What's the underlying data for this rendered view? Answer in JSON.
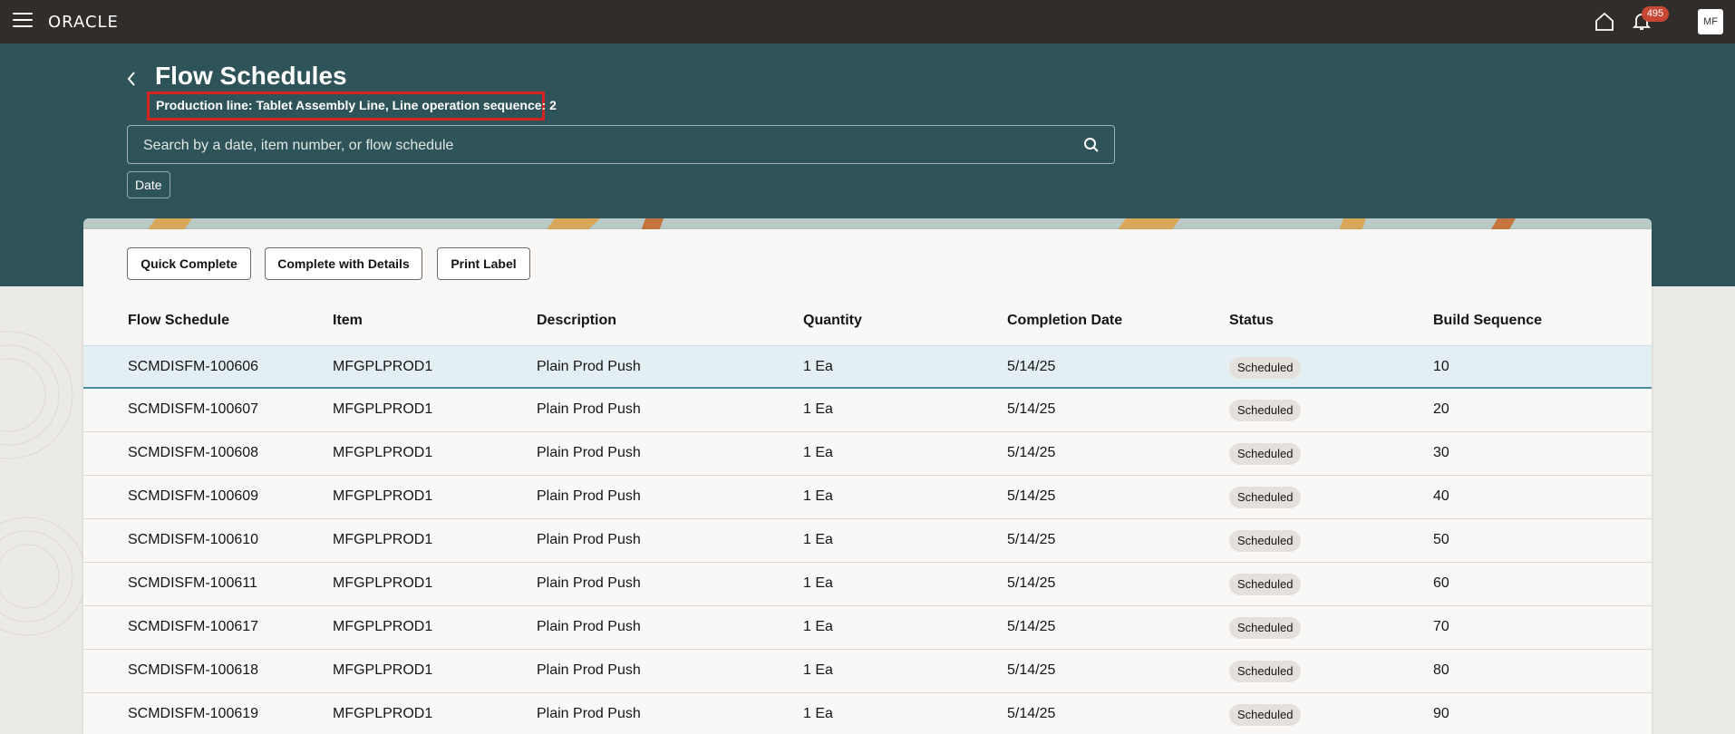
{
  "topbar": {
    "logo": "ORACLE",
    "notification_count": "495",
    "avatar_initials": "MF"
  },
  "page": {
    "title": "Flow Schedules",
    "subtitle": "Production line: Tablet Assembly Line, Line operation sequence: 2"
  },
  "search": {
    "placeholder": "Search by a date, item number, or flow schedule"
  },
  "filters": {
    "date_chip": "Date"
  },
  "toolbar": {
    "quick_complete": "Quick Complete",
    "complete_with_details": "Complete with Details",
    "print_label": "Print Label"
  },
  "table": {
    "headers": [
      "Flow Schedule",
      "Item",
      "Description",
      "Quantity",
      "Completion Date",
      "Status",
      "Build Sequence"
    ],
    "rows": [
      [
        "SCMDISFM-100606",
        "MFGPLPROD1",
        "Plain Prod Push",
        "1 Ea",
        "5/14/25",
        "Scheduled",
        "10"
      ],
      [
        "SCMDISFM-100607",
        "MFGPLPROD1",
        "Plain Prod Push",
        "1 Ea",
        "5/14/25",
        "Scheduled",
        "20"
      ],
      [
        "SCMDISFM-100608",
        "MFGPLPROD1",
        "Plain Prod Push",
        "1 Ea",
        "5/14/25",
        "Scheduled",
        "30"
      ],
      [
        "SCMDISFM-100609",
        "MFGPLPROD1",
        "Plain Prod Push",
        "1 Ea",
        "5/14/25",
        "Scheduled",
        "40"
      ],
      [
        "SCMDISFM-100610",
        "MFGPLPROD1",
        "Plain Prod Push",
        "1 Ea",
        "5/14/25",
        "Scheduled",
        "50"
      ],
      [
        "SCMDISFM-100611",
        "MFGPLPROD1",
        "Plain Prod Push",
        "1 Ea",
        "5/14/25",
        "Scheduled",
        "60"
      ],
      [
        "SCMDISFM-100617",
        "MFGPLPROD1",
        "Plain Prod Push",
        "1 Ea",
        "5/14/25",
        "Scheduled",
        "70"
      ],
      [
        "SCMDISFM-100618",
        "MFGPLPROD1",
        "Plain Prod Push",
        "1 Ea",
        "5/14/25",
        "Scheduled",
        "80"
      ],
      [
        "SCMDISFM-100619",
        "MFGPLPROD1",
        "Plain Prod Push",
        "1 Ea",
        "5/14/25",
        "Scheduled",
        "90"
      ]
    ]
  },
  "colors": {
    "topbar": "#312d2a",
    "hero": "#2e5358",
    "badge": "#c74634",
    "highlight_box": "#d42322",
    "selected_row": "#e4eff4"
  }
}
